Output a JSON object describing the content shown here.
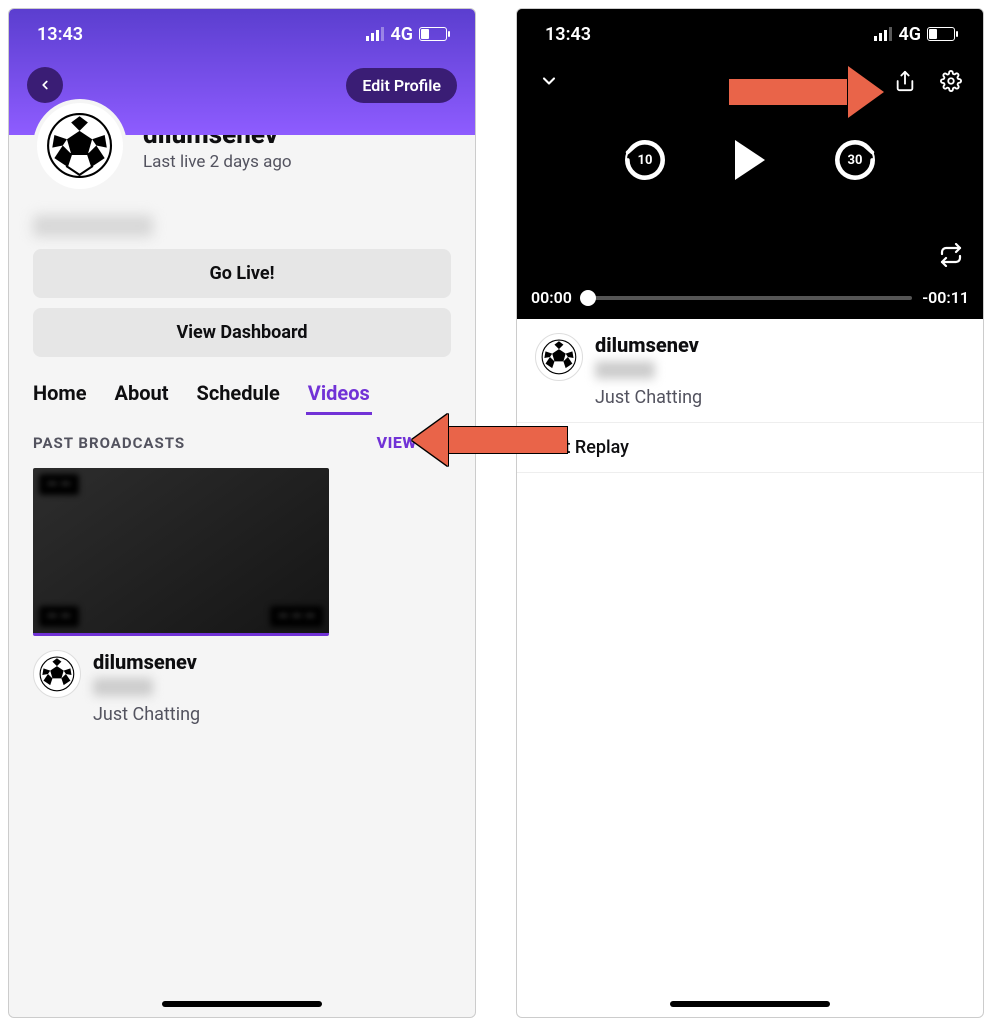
{
  "status": {
    "time": "13:43",
    "network": "4G"
  },
  "left": {
    "edit_label": "Edit Profile",
    "username": "dilumsenev",
    "last_live": "Last live 2 days ago",
    "go_live": "Go Live!",
    "dashboard": "View Dashboard",
    "tabs": {
      "home": "Home",
      "about": "About",
      "schedule": "Schedule",
      "videos": "Videos"
    },
    "section_title": "PAST BROADCASTS",
    "view_all": "VIEW ALL",
    "video": {
      "author": "dilumsenev",
      "category": "Just Chatting"
    }
  },
  "right": {
    "skip_back": "10",
    "skip_fwd": "30",
    "elapsed": "00:00",
    "remaining": "-00:11",
    "author": "dilumsenev",
    "category": "Just Chatting",
    "chat_replay": "Chat Replay"
  }
}
